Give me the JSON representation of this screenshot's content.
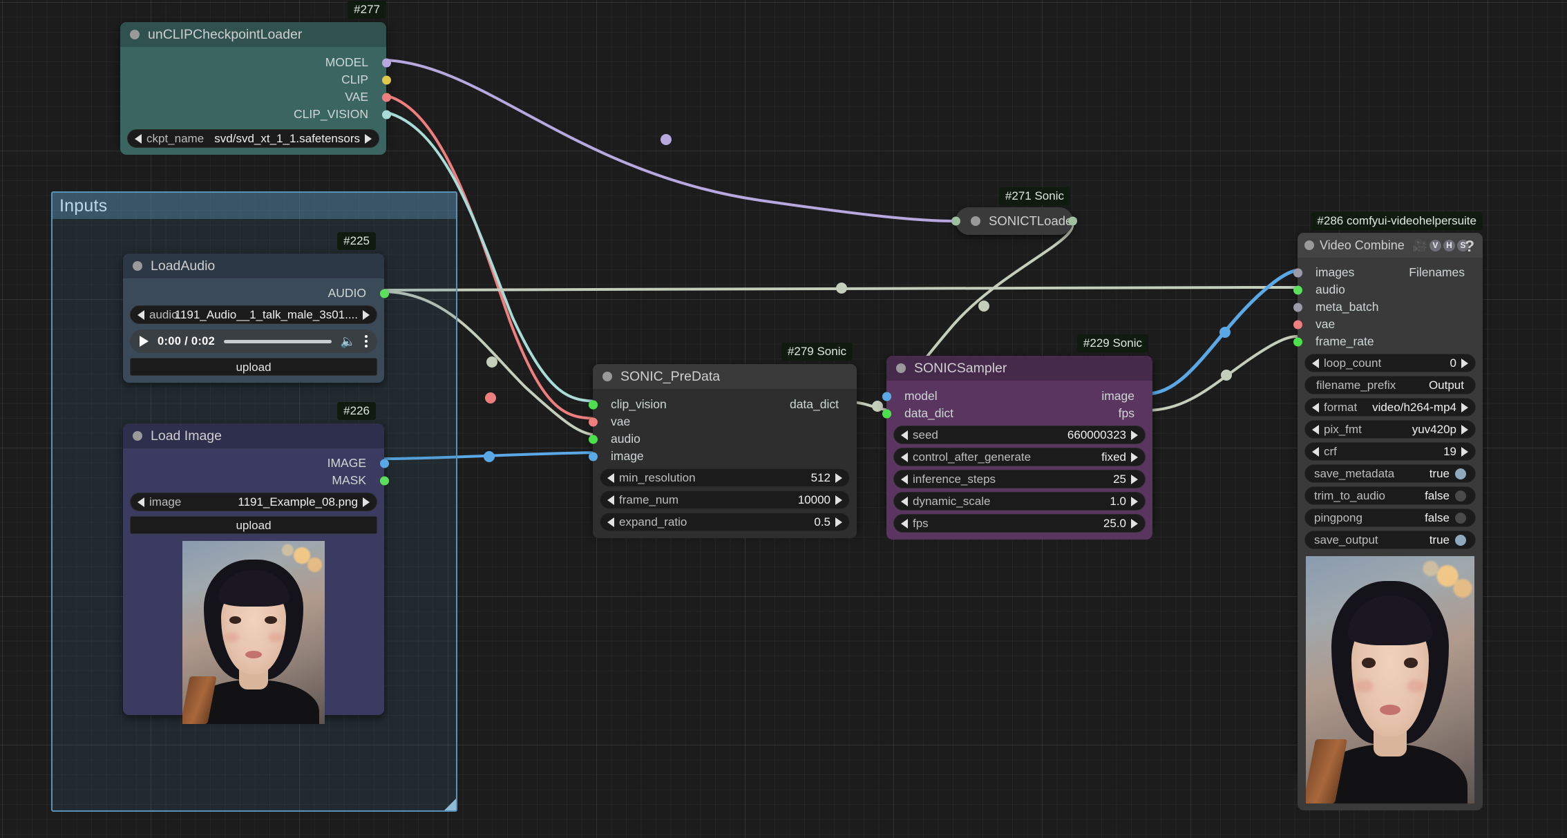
{
  "app": {
    "kind": "node-graph-editor"
  },
  "group": {
    "title": "Inputs",
    "border_color": "#5b93b8"
  },
  "nodes": {
    "unclip_loader": {
      "badge": "#277",
      "title": "unCLIPCheckpointLoader",
      "accent": "#3a6561",
      "header": "#2f524f",
      "outputs": [
        {
          "label": "MODEL",
          "color": "#b7a9e0"
        },
        {
          "label": "CLIP",
          "color": "#e0c84a"
        },
        {
          "label": "VAE",
          "color": "#ef7f7f"
        },
        {
          "label": "CLIP_VISION",
          "color": "#a9dcd8"
        }
      ],
      "widgets": [
        {
          "name": "ckpt_name",
          "value": "svd/svd_xt_1_1.safetensors",
          "type": "combo"
        }
      ]
    },
    "load_audio": {
      "badge": "#225",
      "title": "LoadAudio",
      "accent": "#3b4a58",
      "header": "#2c3845",
      "outputs": [
        {
          "label": "AUDIO",
          "color": "#5ce05c"
        }
      ],
      "widgets": [
        {
          "name": "audio",
          "value": "1191_Audio__1_talk_male_3s01....",
          "type": "combo"
        }
      ],
      "player": {
        "time": "0:00 / 0:02",
        "volume_icon": "speaker-icon",
        "menu_icon": "kebab-menu-icon"
      },
      "button": "upload"
    },
    "load_image": {
      "badge": "#226",
      "title": "Load Image",
      "accent": "#3b3b62",
      "header": "#2e2e4d",
      "outputs": [
        {
          "label": "IMAGE",
          "color": "#5aa9e6"
        },
        {
          "label": "MASK",
          "color": "#5ce05c"
        }
      ],
      "widgets": [
        {
          "name": "image",
          "value": "1191_Example_08.png",
          "type": "combo"
        }
      ],
      "button": "upload"
    },
    "sonic_t_loader": {
      "badge": "#271 Sonic",
      "title": "SONICTLoader",
      "collapsed": true,
      "accent": "#3a3a3a",
      "header": "#3a3a3a",
      "in_dot_color": "#b7a9e0",
      "out_dot_color": "#9fbf9f"
    },
    "sonic_predata": {
      "badge": "#279 Sonic",
      "title": "SONIC_PreData",
      "accent": "#2e2e2e",
      "header": "#3a3a3a",
      "inputs": [
        {
          "label": "clip_vision",
          "color": "#a9dcd8"
        },
        {
          "label": "vae",
          "color": "#ef7f7f"
        },
        {
          "label": "audio",
          "color": "#4ce04c"
        },
        {
          "label": "image",
          "color": "#5aa9e6"
        }
      ],
      "outputs": [
        {
          "label": "data_dict",
          "color": "#4ce04c"
        }
      ],
      "widgets": [
        {
          "name": "min_resolution",
          "value": "512",
          "type": "number"
        },
        {
          "name": "frame_num",
          "value": "10000",
          "type": "number"
        },
        {
          "name": "expand_ratio",
          "value": "0.5",
          "type": "number"
        }
      ]
    },
    "sonic_sampler": {
      "badge": "#229 Sonic",
      "title": "SONICSampler",
      "accent": "#5a3560",
      "header": "#452a4c",
      "inputs": [
        {
          "label": "model",
          "color": "#4ce04c"
        },
        {
          "label": "data_dict",
          "color": "#4ce04c"
        }
      ],
      "outputs": [
        {
          "label": "image",
          "color": "#5aa9e6"
        },
        {
          "label": "fps",
          "color": "#4ce04c"
        }
      ],
      "widgets": [
        {
          "name": "seed",
          "value": "660000323",
          "type": "number"
        },
        {
          "name": "control_after_generate",
          "value": "fixed",
          "type": "combo"
        },
        {
          "name": "inference_steps",
          "value": "25",
          "type": "number"
        },
        {
          "name": "dynamic_scale",
          "value": "1.0",
          "type": "number"
        },
        {
          "name": "fps",
          "value": "25.0",
          "type": "number"
        }
      ]
    },
    "video_combine": {
      "badge": "#286 comfyui-videohelpersuite",
      "title": "Video Combine",
      "header_icons": [
        "movie-camera-icon",
        "V",
        "H",
        "S"
      ],
      "help_label": "?",
      "accent": "#3a3a3a",
      "header": "#434343",
      "inputs": [
        {
          "label": "images",
          "color": "#7ab2e0",
          "hollow": false
        },
        {
          "label": "audio",
          "color": "#5ce05c",
          "hollow": true
        },
        {
          "label": "meta_batch",
          "color": "#9a9aa8",
          "hollow": true
        },
        {
          "label": "vae",
          "color": "#ef7f7f",
          "hollow": true
        },
        {
          "label": "frame_rate",
          "color": "#4ce04c",
          "hollow": false
        }
      ],
      "outputs": [
        {
          "label": "Filenames",
          "color": "#9a9aa8"
        }
      ],
      "widgets": [
        {
          "name": "loop_count",
          "value": "0",
          "type": "number"
        },
        {
          "name": "filename_prefix",
          "value": "Output",
          "type": "text"
        },
        {
          "name": "format",
          "value": "video/h264-mp4",
          "type": "combo"
        },
        {
          "name": "pix_fmt",
          "value": "yuv420p",
          "type": "combo"
        },
        {
          "name": "crf",
          "value": "19",
          "type": "number"
        },
        {
          "name": "save_metadata",
          "value": "true",
          "type": "boolean",
          "on": true
        },
        {
          "name": "trim_to_audio",
          "value": "false",
          "type": "boolean",
          "on": false
        },
        {
          "name": "pingpong",
          "value": "false",
          "type": "boolean",
          "on": false
        },
        {
          "name": "save_output",
          "value": "true",
          "type": "boolean",
          "on": true
        }
      ]
    }
  },
  "link_colors": {
    "model": "#b7a9e0",
    "vae": "#ef7f7f",
    "clip_vision": "#a9dcd8",
    "audio": "#c5cdbb",
    "image": "#5aa9e6",
    "fps": "#c5cdbb",
    "generic": "#c5cdbb"
  }
}
